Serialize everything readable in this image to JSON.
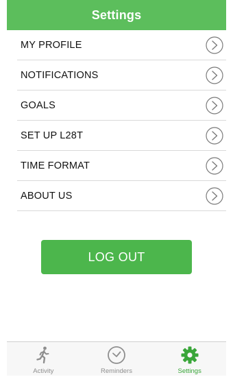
{
  "header": {
    "title": "Settings"
  },
  "menu": {
    "items": [
      {
        "label": "MY PROFILE",
        "icon": "chevron-right-icon"
      },
      {
        "label": "NOTIFICATIONS",
        "icon": "chevron-right-icon"
      },
      {
        "label": "GOALS",
        "icon": "chevron-right-icon"
      },
      {
        "label": "SET UP L28T",
        "icon": "chevron-right-icon"
      },
      {
        "label": "TIME FORMAT",
        "icon": "chevron-right-icon"
      },
      {
        "label": "ABOUT US",
        "icon": "chevron-right-icon"
      }
    ]
  },
  "logout": {
    "label": "LOG OUT"
  },
  "tabbar": {
    "tabs": [
      {
        "label": "Activity",
        "icon": "runner-icon",
        "active": false
      },
      {
        "label": "Reminders",
        "icon": "clock-icon",
        "active": false
      },
      {
        "label": "Settings",
        "icon": "gear-icon",
        "active": true
      }
    ]
  },
  "colors": {
    "header_green": "#5cbe5c",
    "button_green": "#4cb64c",
    "active_tab_green": "#3aa63a",
    "inactive_tab_gray": "#8e8e8e"
  }
}
